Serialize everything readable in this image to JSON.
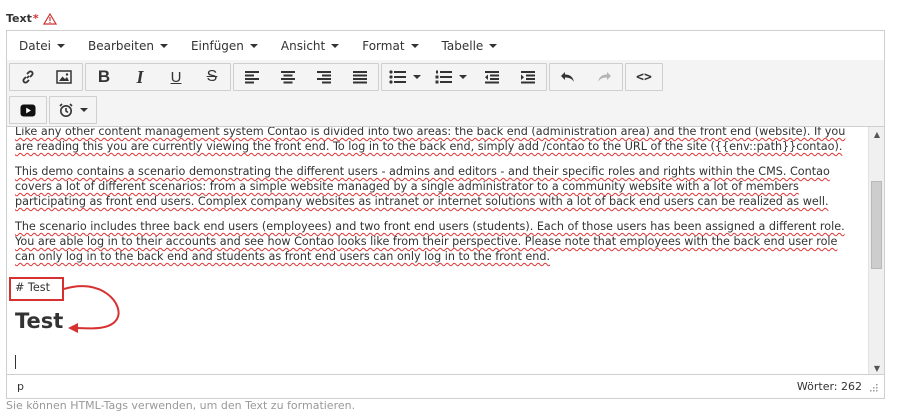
{
  "field": {
    "label": "Text",
    "required_mark": "*",
    "warning_icon": "warning-triangle-icon",
    "help_text": "Sie können HTML-Tags verwenden, um den Text zu formatieren."
  },
  "menubar": {
    "items": [
      {
        "label": "Datei"
      },
      {
        "label": "Bearbeiten"
      },
      {
        "label": "Einfügen"
      },
      {
        "label": "Ansicht"
      },
      {
        "label": "Format"
      },
      {
        "label": "Tabelle"
      }
    ]
  },
  "toolbar": {
    "row1": [
      [
        "link-icon",
        "image-icon"
      ],
      [
        "bold-icon",
        "italic-icon",
        "underline-icon",
        "strikethrough-icon"
      ],
      [
        "align-left-icon",
        "align-center-icon",
        "align-right-icon",
        "align-justify-icon"
      ],
      [
        "bullet-list-icon",
        "numbered-list-icon",
        "outdent-icon",
        "indent-icon"
      ],
      [
        "undo-icon",
        "redo-icon"
      ],
      [
        "source-code-icon"
      ]
    ],
    "row2": [
      [
        "youtube-icon"
      ],
      [
        "alarm-clock-icon"
      ]
    ],
    "bold_glyph": "B",
    "italic_glyph": "I",
    "underline_glyph": "U",
    "strike_glyph": "S",
    "source_glyph": "<>"
  },
  "content": {
    "paragraphs": [
      "Like any other content management system Contao is divided into two areas: the back end (administration area) and the front end (website). If you are reading this you are currently viewing the front end. To log in to the back end, simply add /contao to the URL of the site ({{env::path}}contao).",
      "This demo contains a scenario demonstrating the different users - admins and editors - and their specific roles and rights within the CMS. Contao covers a lot of different scenarios: from a simple website managed by a single administrator to a community website with a lot of members participating as front end users. Complex company websites as intranet or internet solutions with a lot of back end users can be realized as well.",
      "The scenario includes three back end users (employees) and two front end users (students). Each of those users has been assigned a different role. You are able log in to their accounts and see how Contao looks like from their perspective. Please note that employees with the back end user role can only log in to the back end and students as front end users can only log in to the front end."
    ],
    "markdown_line": "# Test",
    "heading": "Test"
  },
  "statusbar": {
    "path": "p",
    "word_count": "Wörter: 262"
  },
  "colors": {
    "annotation_red": "#d63031",
    "spellcheck_red": "#dd3333"
  }
}
